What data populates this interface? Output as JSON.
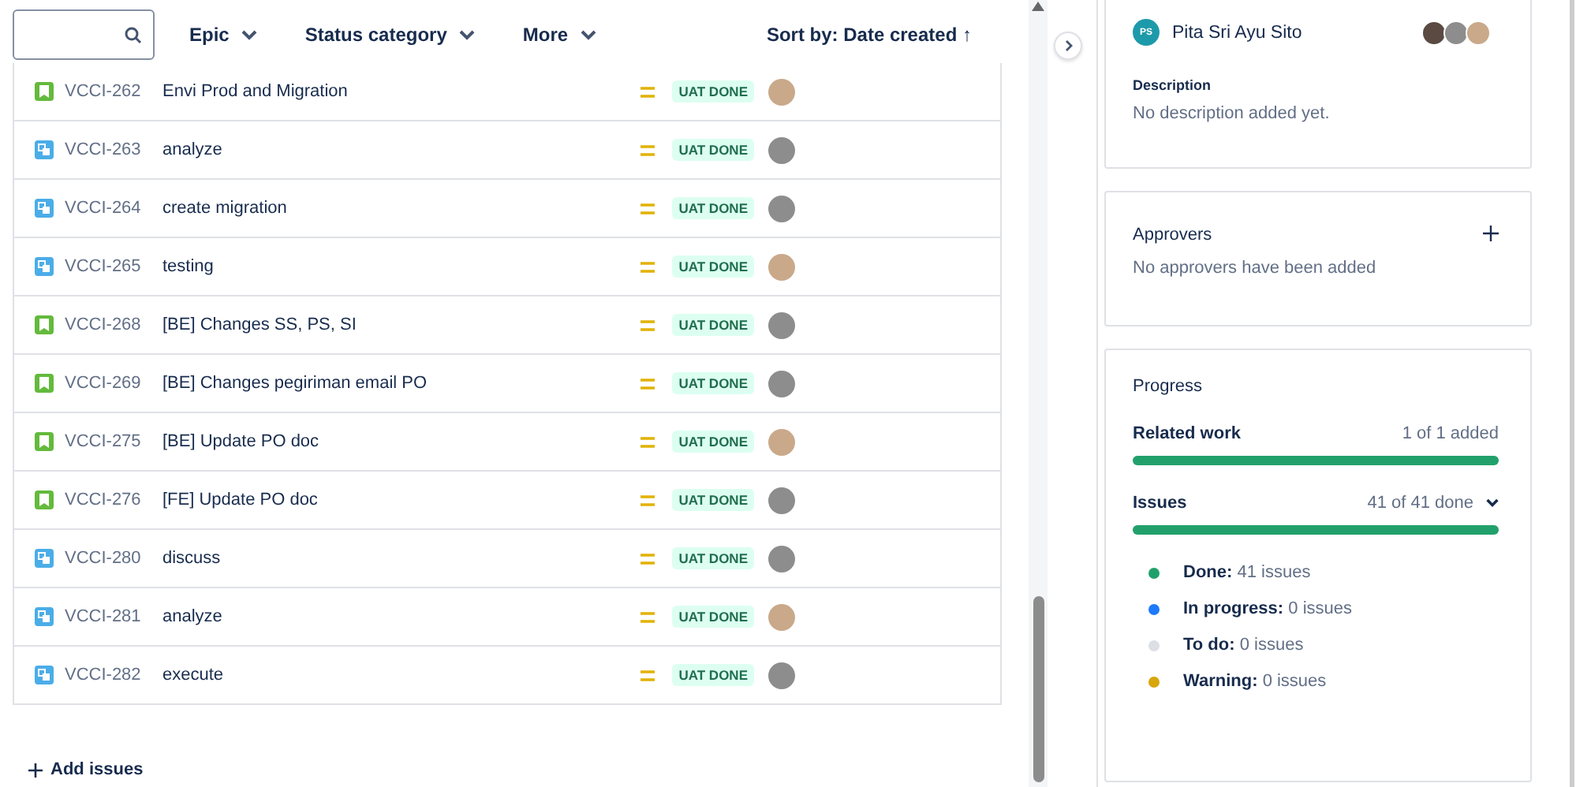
{
  "filters": {
    "dropdowns": [
      {
        "label": "Epic"
      },
      {
        "label": "Status category"
      },
      {
        "label": "More"
      }
    ],
    "sort": {
      "label": "Sort by: Date created",
      "arrow": "↑"
    }
  },
  "issues": [
    {
      "key": "VCCI-262",
      "kind": "story",
      "summary": "Envi Prod and Migration",
      "status": "UAT DONE"
    },
    {
      "key": "VCCI-263",
      "kind": "subtask",
      "summary": "analyze",
      "status": "UAT DONE"
    },
    {
      "key": "VCCI-264",
      "kind": "subtask",
      "summary": "create migration",
      "status": "UAT DONE"
    },
    {
      "key": "VCCI-265",
      "kind": "subtask",
      "summary": "testing",
      "status": "UAT DONE"
    },
    {
      "key": "VCCI-268",
      "kind": "story",
      "summary": "[BE] Changes SS, PS, SI",
      "status": "UAT DONE"
    },
    {
      "key": "VCCI-269",
      "kind": "story",
      "summary": "[BE] Changes pegiriman email PO",
      "status": "UAT DONE"
    },
    {
      "key": "VCCI-275",
      "kind": "story",
      "summary": "[BE] Update PO doc",
      "status": "UAT DONE"
    },
    {
      "key": "VCCI-276",
      "kind": "story",
      "summary": "[FE] Update PO doc",
      "status": "UAT DONE"
    },
    {
      "key": "VCCI-280",
      "kind": "subtask",
      "summary": "discuss",
      "status": "UAT DONE"
    },
    {
      "key": "VCCI-281",
      "kind": "subtask",
      "summary": "analyze",
      "status": "UAT DONE"
    },
    {
      "key": "VCCI-282",
      "kind": "subtask",
      "summary": "execute",
      "status": "UAT DONE"
    }
  ],
  "add_issues": {
    "label": "Add issues"
  },
  "details": {
    "driver": {
      "initials": "PS",
      "name": "Pita Sri Ayu Sito"
    },
    "description": {
      "heading": "Description",
      "text": "No description added yet."
    }
  },
  "approvers": {
    "heading": "Approvers",
    "text": "No approvers have been added"
  },
  "progress": {
    "heading": "Progress",
    "related_work": {
      "label": "Related work",
      "summary": "1 of 1 added",
      "level": 1
    },
    "issues": {
      "label": "Issues",
      "summary": "41 of 41 done",
      "level": 1
    },
    "legend": [
      {
        "label": "Done:",
        "count": "41 issues",
        "color": "#22a06b"
      },
      {
        "label": "In progress:",
        "count": "0 issues",
        "color": "#1d7afc"
      },
      {
        "label": "To do:",
        "count": "0 issues",
        "color": "#dcdfe4"
      },
      {
        "label": "Warning:",
        "count": "0 issues",
        "color": "#d8a50c"
      }
    ]
  }
}
